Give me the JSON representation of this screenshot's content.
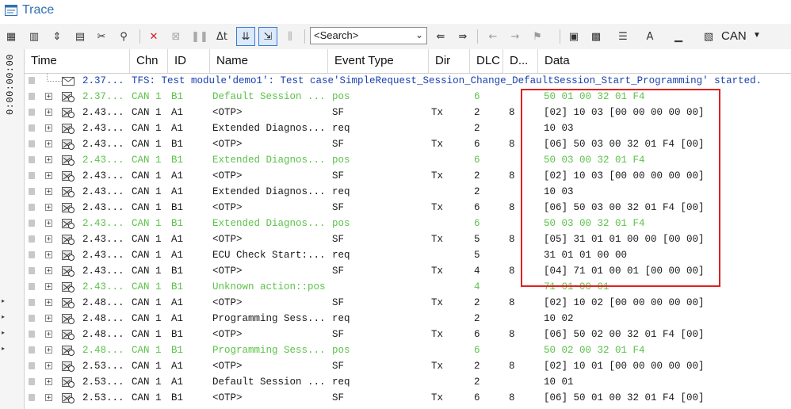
{
  "window": {
    "title": "Trace"
  },
  "toolbar": {
    "search_placeholder": "<Search>",
    "delta_label": "Δt",
    "can_label": "CAN"
  },
  "sidebar": {
    "time_label": "0:00:00:00"
  },
  "columns": [
    "Time",
    "Chn",
    "ID",
    "Name",
    "Event Type",
    "Dir",
    "DLC",
    "D...",
    "Data"
  ],
  "colors": {
    "green": "#5cc24a",
    "blue": "#1a3fb0",
    "normal": "#1a1a1a",
    "highlight": "#e02020"
  },
  "rows": [
    {
      "kind": "tfs",
      "time": "2.37...",
      "text": "TFS: Test module'demo1': Test case'SimpleRequest_Session_Change_DefaultSession_Start_Programming' started."
    },
    {
      "kind": "green",
      "time": "2.37...",
      "chn": "CAN 1",
      "id": "B1",
      "name": "Default Session ...",
      "event": "pos",
      "dir": "",
      "dlc": "6",
      "d": "",
      "data": "50 01 00 32 01 F4"
    },
    {
      "kind": "normal",
      "time": "2.43...",
      "chn": "CAN 1",
      "id": "A1",
      "name": "<OTP>",
      "event": "SF",
      "dir": "Tx",
      "dlc": "2",
      "d": "8",
      "data": "[02] 10 03 [00 00 00 00 00]"
    },
    {
      "kind": "normal",
      "time": "2.43...",
      "chn": "CAN 1",
      "id": "A1",
      "name": "Extended Diagnos...",
      "event": "req",
      "dir": "",
      "dlc": "2",
      "d": "",
      "data": "10 03"
    },
    {
      "kind": "normal",
      "time": "2.43...",
      "chn": "CAN 1",
      "id": "B1",
      "name": "<OTP>",
      "event": "SF",
      "dir": "Tx",
      "dlc": "6",
      "d": "8",
      "data": "[06] 50 03 00 32 01 F4 [00]"
    },
    {
      "kind": "green",
      "time": "2.43...",
      "chn": "CAN 1",
      "id": "B1",
      "name": "Extended Diagnos...",
      "event": "pos",
      "dir": "",
      "dlc": "6",
      "d": "",
      "data": "50 03 00 32 01 F4"
    },
    {
      "kind": "normal",
      "time": "2.43...",
      "chn": "CAN 1",
      "id": "A1",
      "name": "<OTP>",
      "event": "SF",
      "dir": "Tx",
      "dlc": "2",
      "d": "8",
      "data": "[02] 10 03 [00 00 00 00 00]"
    },
    {
      "kind": "normal",
      "time": "2.43...",
      "chn": "CAN 1",
      "id": "A1",
      "name": "Extended Diagnos...",
      "event": "req",
      "dir": "",
      "dlc": "2",
      "d": "",
      "data": "10 03"
    },
    {
      "kind": "normal",
      "time": "2.43...",
      "chn": "CAN 1",
      "id": "B1",
      "name": "<OTP>",
      "event": "SF",
      "dir": "Tx",
      "dlc": "6",
      "d": "8",
      "data": "[06] 50 03 00 32 01 F4 [00]"
    },
    {
      "kind": "green",
      "time": "2.43...",
      "chn": "CAN 1",
      "id": "B1",
      "name": "Extended Diagnos...",
      "event": "pos",
      "dir": "",
      "dlc": "6",
      "d": "",
      "data": "50 03 00 32 01 F4"
    },
    {
      "kind": "normal",
      "time": "2.43...",
      "chn": "CAN 1",
      "id": "A1",
      "name": "<OTP>",
      "event": "SF",
      "dir": "Tx",
      "dlc": "5",
      "d": "8",
      "data": "[05] 31 01 01 00 00 [00 00]"
    },
    {
      "kind": "normal",
      "time": "2.43...",
      "chn": "CAN 1",
      "id": "A1",
      "name": "ECU Check Start:...",
      "event": "req",
      "dir": "",
      "dlc": "5",
      "d": "",
      "data": "31 01 01 00 00"
    },
    {
      "kind": "normal",
      "time": "2.43...",
      "chn": "CAN 1",
      "id": "B1",
      "name": "<OTP>",
      "event": "SF",
      "dir": "Tx",
      "dlc": "4",
      "d": "8",
      "data": "[04] 71 01 00 01 [00 00 00]"
    },
    {
      "kind": "green",
      "time": "2.43...",
      "chn": "CAN 1",
      "id": "B1",
      "name": "Unknown action::pos",
      "event": "",
      "dir": "",
      "dlc": "4",
      "d": "",
      "data": "71 01 00 01"
    },
    {
      "kind": "normal",
      "time": "2.48...",
      "chn": "CAN 1",
      "id": "A1",
      "name": "<OTP>",
      "event": "SF",
      "dir": "Tx",
      "dlc": "2",
      "d": "8",
      "data": "[02] 10 02 [00 00 00 00 00]"
    },
    {
      "kind": "normal",
      "time": "2.48...",
      "chn": "CAN 1",
      "id": "A1",
      "name": "Programming Sess...",
      "event": "req",
      "dir": "",
      "dlc": "2",
      "d": "",
      "data": "10 02"
    },
    {
      "kind": "normal",
      "time": "2.48...",
      "chn": "CAN 1",
      "id": "B1",
      "name": "<OTP>",
      "event": "SF",
      "dir": "Tx",
      "dlc": "6",
      "d": "8",
      "data": "[06] 50 02 00 32 01 F4 [00]"
    },
    {
      "kind": "green",
      "time": "2.48...",
      "chn": "CAN 1",
      "id": "B1",
      "name": "Programming Sess...",
      "event": "pos",
      "dir": "",
      "dlc": "6",
      "d": "",
      "data": "50 02 00 32 01 F4"
    },
    {
      "kind": "normal",
      "time": "2.53...",
      "chn": "CAN 1",
      "id": "A1",
      "name": "<OTP>",
      "event": "SF",
      "dir": "Tx",
      "dlc": "2",
      "d": "8",
      "data": "[02] 10 01 [00 00 00 00 00]"
    },
    {
      "kind": "normal",
      "time": "2.53...",
      "chn": "CAN 1",
      "id": "A1",
      "name": "Default Session ...",
      "event": "req",
      "dir": "",
      "dlc": "2",
      "d": "",
      "data": "10 01"
    },
    {
      "kind": "normal",
      "time": "2.53...",
      "chn": "CAN 1",
      "id": "B1",
      "name": "<OTP>",
      "event": "SF",
      "dir": "Tx",
      "dlc": "6",
      "d": "8",
      "data": "[06] 50 01 00 32 01 F4 [00]"
    }
  ]
}
